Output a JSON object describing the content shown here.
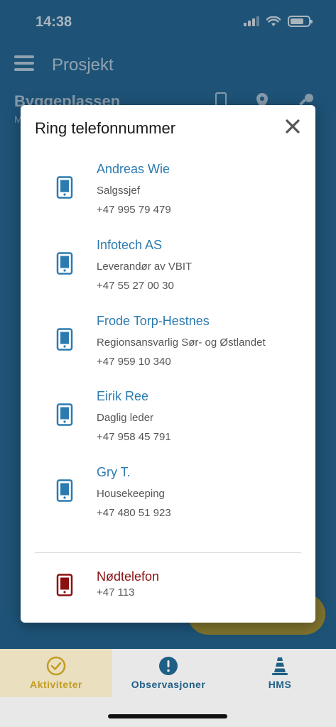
{
  "status_bar": {
    "time": "14:38"
  },
  "header": {
    "title": "Prosjekt"
  },
  "project": {
    "name": "Byggeplassen",
    "subtitle_fragment": "M"
  },
  "modal": {
    "title": "Ring telefonnummer",
    "contacts": [
      {
        "name": "Andreas Wie",
        "role": "Salgssjef",
        "phone": "+47 995 79 479"
      },
      {
        "name": "Infotech AS",
        "role": "Leverandør av VBIT",
        "phone": "+47 55 27 00 30"
      },
      {
        "name": "Frode Torp-Hestnes",
        "role": "Regionsansvarlig Sør- og Østlandet",
        "phone": "+47 959 10 340"
      },
      {
        "name": "Eirik Ree",
        "role": "Daglig leder",
        "phone": "+47 958 45 791"
      },
      {
        "name": "Gry T.",
        "role": "Housekeeping",
        "phone": "+47 480 51 923"
      }
    ],
    "emergency": {
      "name": "Nødtelefon",
      "phone": "+47 113"
    }
  },
  "tabs": [
    {
      "label": "Aktiviteter",
      "icon": "check-circle-icon",
      "active": true
    },
    {
      "label": "Observasjoner",
      "icon": "exclamation-circle-icon",
      "active": false
    },
    {
      "label": "HMS",
      "icon": "traffic-cone-icon",
      "active": false
    }
  ],
  "colors": {
    "accent_blue": "#2b7bb0",
    "emergency_red": "#8b1010",
    "active_tab": "#c29d24",
    "tab_text": "#1f5f85"
  }
}
